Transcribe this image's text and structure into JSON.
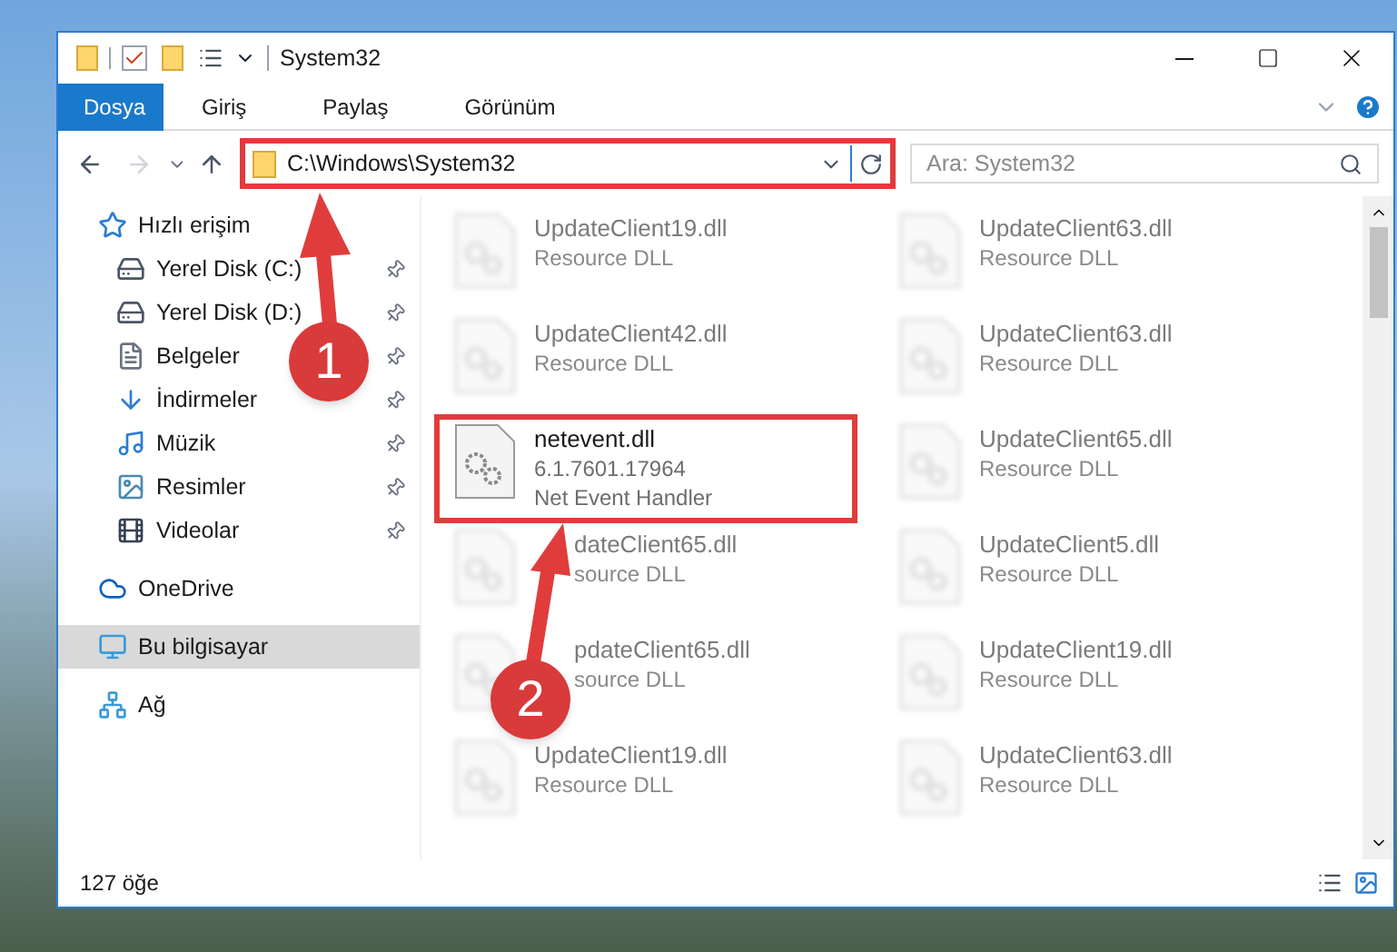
{
  "window": {
    "title": "System32"
  },
  "ribbon_tabs": [
    {
      "label": "Dosya",
      "selected": true
    },
    {
      "label": "Giriş",
      "selected": false
    },
    {
      "label": "Paylaş",
      "selected": false
    },
    {
      "label": "Görünüm",
      "selected": false
    }
  ],
  "address": {
    "path": "C:\\Windows\\System32"
  },
  "search": {
    "placeholder": "Ara: System32"
  },
  "sidebar": {
    "items": [
      {
        "label": "Hızlı erişim",
        "kind": "quick",
        "pinned": false,
        "selected": false,
        "children": [
          {
            "label": "Yerel Disk (C:)",
            "kind": "drive_c",
            "pinned": true,
            "selected": false
          },
          {
            "label": "Yerel Disk (D:)",
            "kind": "drive",
            "pinned": true,
            "selected": false
          },
          {
            "label": "Belgeler",
            "kind": "docs",
            "pinned": true,
            "selected": false
          },
          {
            "label": "İndirmeler",
            "kind": "downloads",
            "pinned": true,
            "selected": false
          },
          {
            "label": "Müzik",
            "kind": "music",
            "pinned": true,
            "selected": false
          },
          {
            "label": "Resimler",
            "kind": "pictures",
            "pinned": true,
            "selected": false
          },
          {
            "label": "Videolar",
            "kind": "videos",
            "pinned": true,
            "selected": false
          }
        ]
      },
      {
        "label": "OneDrive",
        "kind": "cloud",
        "pinned": false,
        "selected": false
      },
      {
        "label": "Bu bilgisayar",
        "kind": "pc",
        "pinned": false,
        "selected": true
      },
      {
        "label": "Ağ",
        "kind": "network",
        "pinned": false,
        "selected": false
      }
    ]
  },
  "files": [
    {
      "name": "UpdateClient19.dll",
      "lines": [
        "Resource DLL"
      ],
      "blurred": true,
      "highlighted": false,
      "covered": false
    },
    {
      "name": "UpdateClient63.dll",
      "lines": [
        "Resource DLL"
      ],
      "blurred": true,
      "highlighted": false,
      "covered": false
    },
    {
      "name": "UpdateClient42.dll",
      "lines": [
        "Resource DLL"
      ],
      "blurred": true,
      "highlighted": false,
      "covered": false
    },
    {
      "name": "UpdateClient63.dll",
      "lines": [
        "Resource DLL"
      ],
      "blurred": true,
      "highlighted": false,
      "covered": false
    },
    {
      "name": "netevent.dll",
      "lines": [
        "6.1.7601.17964",
        "Net Event Handler"
      ],
      "blurred": false,
      "highlighted": true,
      "covered": false
    },
    {
      "name": "UpdateClient65.dll",
      "lines": [
        "Resource DLL"
      ],
      "blurred": true,
      "highlighted": false,
      "covered": false
    },
    {
      "name": "dateClient65.dll",
      "lines": [
        "source DLL"
      ],
      "blurred": true,
      "highlighted": false,
      "covered": true
    },
    {
      "name": "UpdateClient5.dll",
      "lines": [
        "Resource DLL"
      ],
      "blurred": true,
      "highlighted": false,
      "covered": false
    },
    {
      "name": "pdateClient65.dll",
      "lines": [
        "source DLL"
      ],
      "blurred": true,
      "highlighted": false,
      "covered": true
    },
    {
      "name": "UpdateClient19.dll",
      "lines": [
        "Resource DLL"
      ],
      "blurred": true,
      "highlighted": false,
      "covered": false
    },
    {
      "name": "UpdateClient19.dll",
      "lines": [
        "Resource DLL"
      ],
      "blurred": true,
      "highlighted": false,
      "covered": false
    },
    {
      "name": "UpdateClient63.dll",
      "lines": [
        "Resource DLL"
      ],
      "blurred": true,
      "highlighted": false,
      "covered": false
    }
  ],
  "status_bar": {
    "count": "127 öğe"
  },
  "annotations": [
    {
      "number": "1"
    },
    {
      "number": "2"
    }
  ]
}
